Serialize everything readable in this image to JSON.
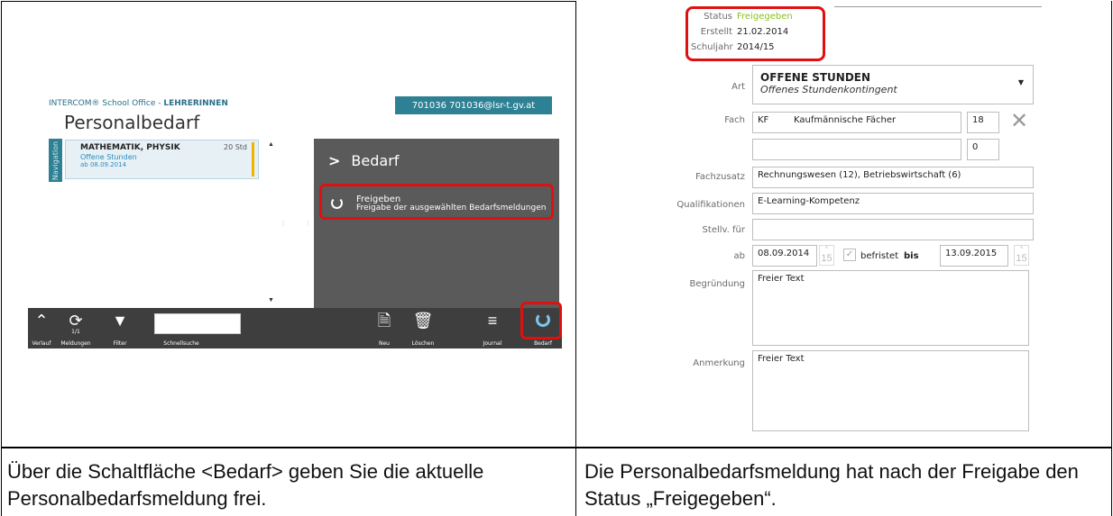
{
  "left_screen": {
    "app_brand": "INTERCOM® School Office - ",
    "app_role": "LEHRERINNEN",
    "user_badge": "701036  701036@lsr-t.gv.at",
    "page_title": "Personalbedarf",
    "nav_label": "Navigation",
    "card": {
      "title": "MATHEMATIK, PHYSIK",
      "hours": "20 Std",
      "subtitle": "Offene Stunden",
      "date": "ab 08.09.2014"
    },
    "panel": {
      "header": "Bedarf",
      "action_title": "Freigeben",
      "action_desc": "Freigabe der ausgewählten Bedarfsmeldungen"
    },
    "toolbar": {
      "verlauf": "Verlauf",
      "meldungen_count": "1/1",
      "meldungen": "Meldungen",
      "filter": "Filter",
      "schnellsuche": "Schnellsuche",
      "neu": "Neu",
      "loeschen": "Löschen",
      "journal": "Journal",
      "bedarf": "Bedarf"
    }
  },
  "right_screen": {
    "status_label": "Status",
    "status_value": "Freigegeben",
    "erstellt_label": "Erstellt",
    "erstellt_value": "21.02.2014",
    "schuljahr_label": "Schuljahr",
    "schuljahr_value": "2014/15",
    "art_label": "Art",
    "art_title": "OFFENE STUNDEN",
    "art_sub": "Offenes Stundenkontingent",
    "fach_label": "Fach",
    "fach_code": "KF",
    "fach_name": "Kaufmännische Fächer",
    "fach_hours": "18",
    "fach2_hours": "0",
    "fachzusatz_label": "Fachzusatz",
    "fachzusatz_value": "Rechnungswesen (12), Betriebswirtschaft (6)",
    "qualifikationen_label": "Qualifikationen",
    "qualifikationen_value": "E-Learning-Kompetenz",
    "stellv_label": "Stellv. für",
    "ab_label": "ab",
    "ab_value": "08.09.2014",
    "ab_spin": "15",
    "befristet_label": "befristet",
    "bis_label": "bis",
    "bis_value": "13.09.2015",
    "bis_spin": "15",
    "begruendung_label": "Begründung",
    "begruendung_value": "Freier Text",
    "anmerkung_label": "Anmerkung",
    "anmerkung_value": "Freier Text",
    "status_color": "#8bbf1f"
  },
  "captions": {
    "left": "Über die Schaltfläche <Bedarf> geben Sie die aktuelle Personalbedarfsmeldung frei.",
    "right": "Die Personalbedarfsmeldung hat nach der Freigabe den Status „Freigegeben“."
  }
}
